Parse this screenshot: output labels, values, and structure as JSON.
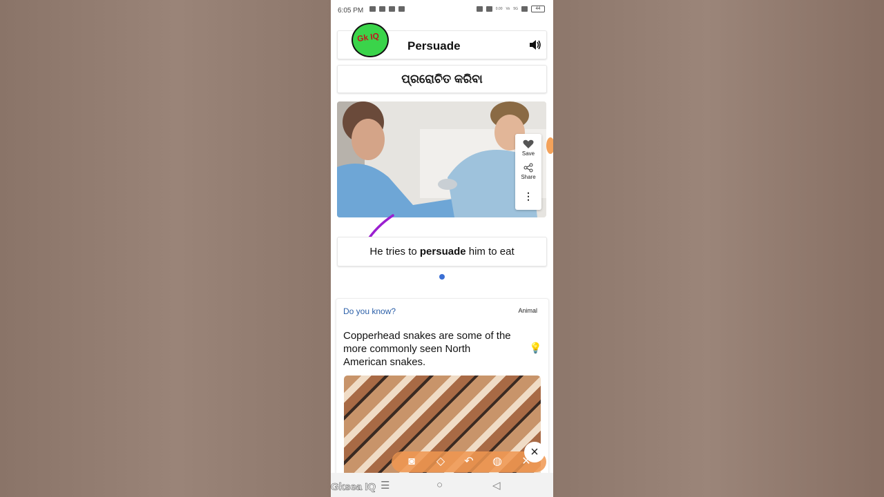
{
  "status_bar": {
    "time": "6:05 PM",
    "speed": "0.00",
    "network_a": "Vo",
    "network_b": "5G",
    "battery": "44"
  },
  "word_card": {
    "logo_text": "Gk IQ",
    "word": "Persuade",
    "speaker_icon": "speaker-icon"
  },
  "translation": "ପ୍ରରୋଚିତ କରିବା",
  "image_actions": {
    "save": "Save",
    "share": "Share"
  },
  "example": {
    "before": "He tries to ",
    "keyword": "persuade",
    "after": " him to eat"
  },
  "did_you_know": {
    "title": "Do you know?",
    "category": "Animal",
    "fact": "Copperhead snakes are some of the more commonly seen North American snakes."
  },
  "colors": {
    "accent_blue": "#2b5fa8",
    "dot_blue": "#3b6fd4",
    "scribble": "#9b1fd0",
    "toolbar": "#f0964f"
  },
  "draw_toolbar": [
    "camera-icon",
    "eraser-icon",
    "undo-icon",
    "palette-icon",
    "close-icon"
  ],
  "close_button": "×",
  "watermark": "Gksea IQ",
  "nav": {
    "menu": "☰",
    "home": "○",
    "back": "◁"
  }
}
